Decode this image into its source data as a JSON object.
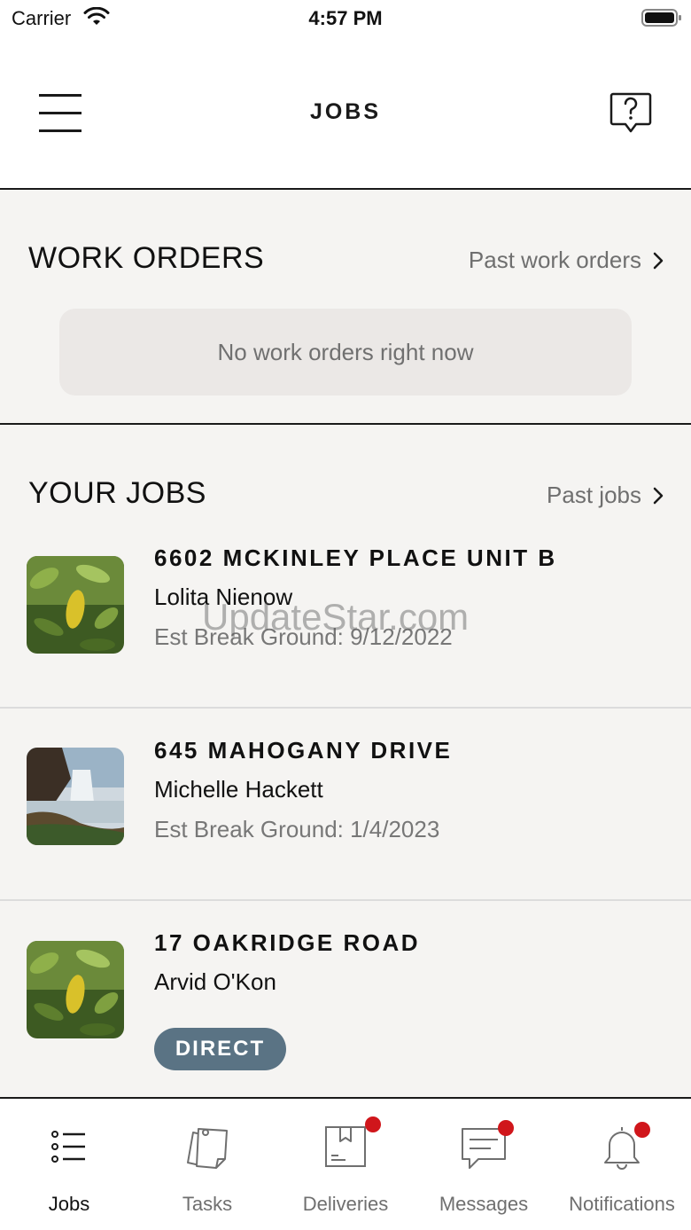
{
  "status_bar": {
    "carrier": "Carrier",
    "time": "4:57 PM"
  },
  "header": {
    "title": "JOBS",
    "menu_icon": "hamburger-menu-icon",
    "help_icon": "help-chat-icon"
  },
  "work_orders": {
    "title": "WORK ORDERS",
    "link_label": "Past work orders",
    "empty_message": "No work orders right now"
  },
  "your_jobs": {
    "title": "YOUR JOBS",
    "link_label": "Past jobs",
    "items": [
      {
        "address": "6602 MCKINLEY PLACE UNIT B",
        "client": "Lolita Nienow",
        "meta": "Est Break Ground: 9/12/2022",
        "thumbnail": "leaves-photo"
      },
      {
        "address": "645 MAHOGANY DRIVE",
        "client": "Michelle Hackett",
        "meta": "Est Break Ground: 1/4/2023",
        "thumbnail": "waterfall-photo"
      },
      {
        "address": "17 OAKRIDGE ROAD",
        "client": "Arvid O'Kon",
        "badge": "DIRECT",
        "thumbnail": "leaves-photo"
      }
    ]
  },
  "watermark": "UpdateStar.com",
  "tab_bar": {
    "tabs": [
      {
        "label": "Jobs",
        "icon": "list-icon",
        "active": true,
        "notification": false
      },
      {
        "label": "Tasks",
        "icon": "sticky-notes-icon",
        "active": false,
        "notification": false
      },
      {
        "label": "Deliveries",
        "icon": "package-icon",
        "active": false,
        "notification": true
      },
      {
        "label": "Messages",
        "icon": "chat-bubble-icon",
        "active": false,
        "notification": true
      },
      {
        "label": "Notifications",
        "icon": "bell-icon",
        "active": false,
        "notification": true
      }
    ]
  },
  "colors": {
    "accent_badge": "#5a7384",
    "notification_dot": "#d0161b",
    "background": "#f5f4f2"
  }
}
